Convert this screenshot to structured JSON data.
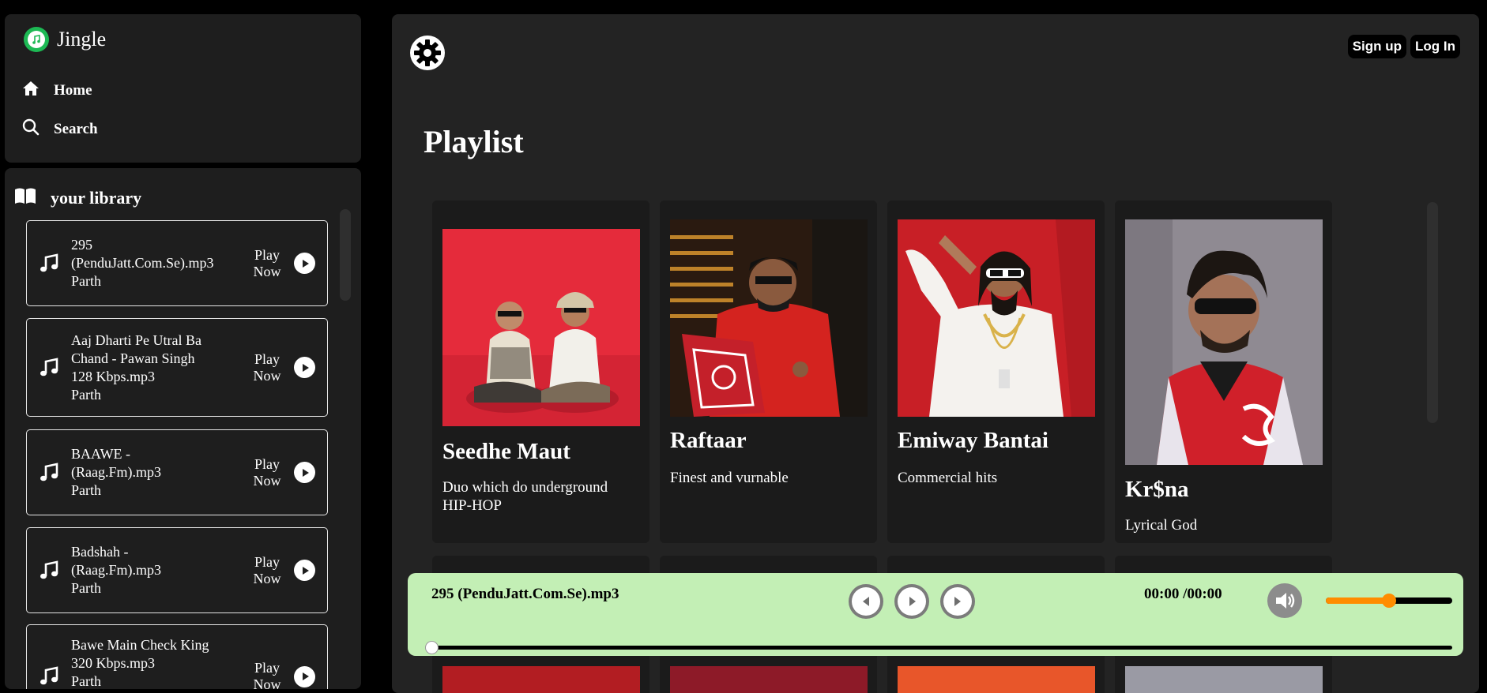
{
  "app": {
    "name": "Jingle"
  },
  "nav": {
    "home": "Home",
    "search": "Search"
  },
  "library": {
    "title": "your library",
    "songs": [
      {
        "lines": [
          "295",
          "(PenduJatt.Com.Se).mp3",
          "Parth"
        ],
        "play_label": [
          "Play",
          "Now"
        ]
      },
      {
        "lines": [
          "Aaj Dharti Pe Utral Ba",
          "Chand - Pawan Singh",
          "128 Kbps.mp3",
          "Parth"
        ],
        "play_label": [
          "Play",
          "Now"
        ]
      },
      {
        "lines": [
          "BAAWE -",
          "(Raag.Fm).mp3",
          "Parth"
        ],
        "play_label": [
          "Play",
          "Now"
        ]
      },
      {
        "lines": [
          "Badshah -",
          "(Raag.Fm).mp3",
          "Parth"
        ],
        "play_label": [
          "Play",
          "Now"
        ]
      },
      {
        "lines": [
          "Bawe Main Check King",
          "320 Kbps.mp3",
          "Parth"
        ],
        "play_label": [
          "Play",
          "Now"
        ]
      }
    ]
  },
  "header": {
    "signup": "Sign up",
    "login": "Log In"
  },
  "main": {
    "title": "Playlist",
    "playlists": [
      {
        "name": "Seedhe Maut",
        "description": "Duo which do underground HIP-HOP"
      },
      {
        "name": "Raftaar",
        "description": "Finest and vurnable"
      },
      {
        "name": "Emiway Bantai",
        "description": "Commercial hits"
      },
      {
        "name": "Kr$na",
        "description": "Lyrical God"
      }
    ]
  },
  "player": {
    "track": "295 (PenduJatt.Com.Se).mp3",
    "time": "00:00 /00:00",
    "volume_fraction": 0.5,
    "progress_fraction": 0
  },
  "colors": {
    "accent": "#1db954",
    "player_bg": "#c3efb5",
    "volume": "#ff8c00"
  }
}
